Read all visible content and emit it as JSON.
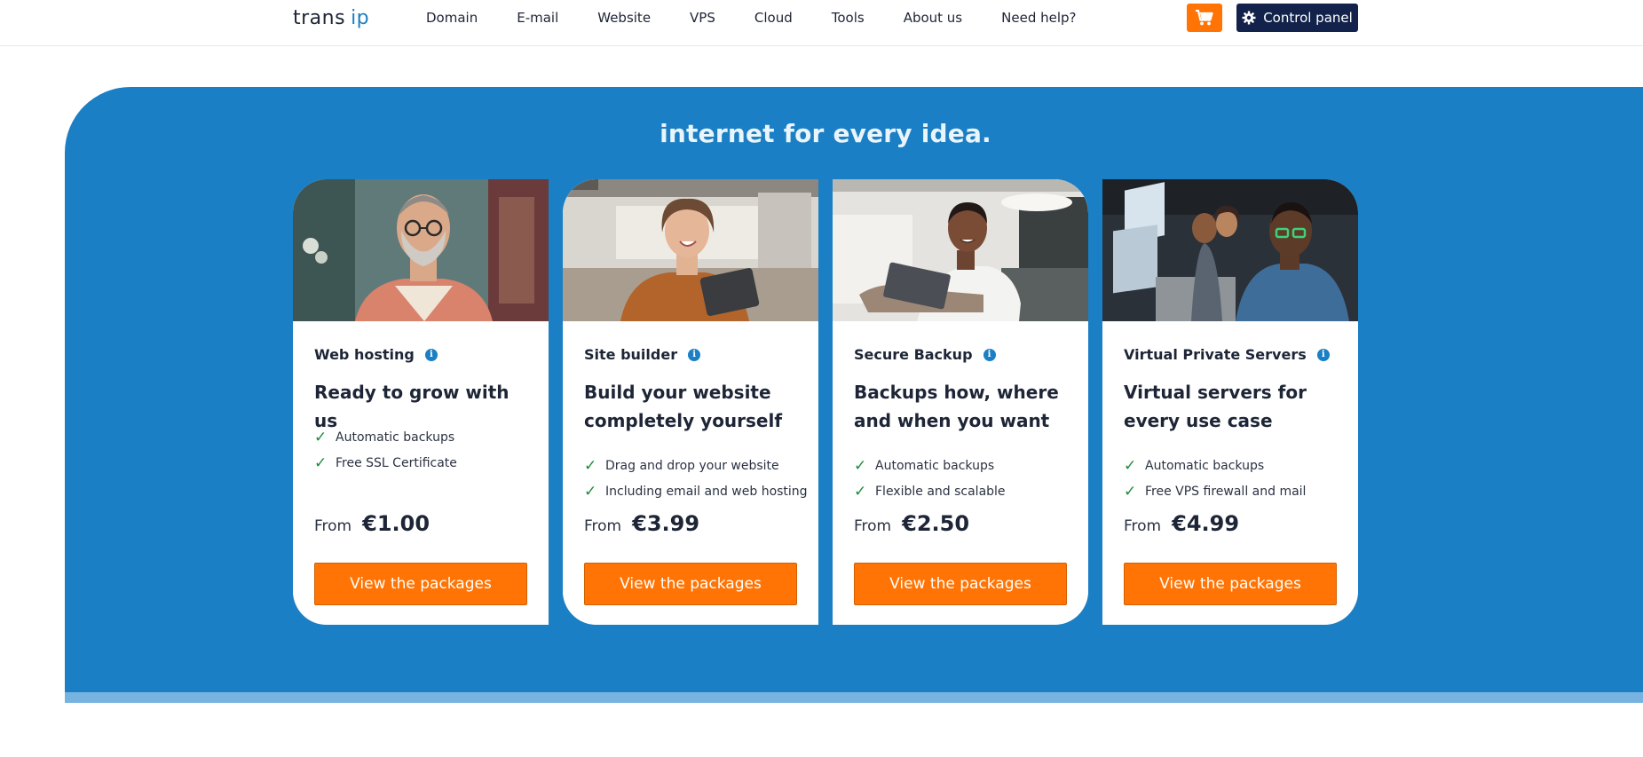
{
  "header": {
    "logo_part1": "trans",
    "logo_part2": "ip",
    "nav": [
      "Domain",
      "E-mail",
      "Website",
      "VPS",
      "Cloud",
      "Tools",
      "About us",
      "Need help?"
    ],
    "cart_icon": "cart-icon",
    "control_panel_label": "Control panel",
    "control_panel_icon": "gear-icon"
  },
  "hero": {
    "title": "internet for every idea."
  },
  "colors": {
    "brand_blue": "#1a7fc4",
    "accent_orange": "#ff7404",
    "navy": "#12224a",
    "check_green": "#1e8a3e"
  },
  "cards": [
    {
      "service": "Web hosting",
      "headline": "Ready to grow with us",
      "features": [
        "Automatic backups",
        "Free SSL Certificate"
      ],
      "from_label": "From",
      "price": "€1.00",
      "cta": "View the packages"
    },
    {
      "service": "Site builder",
      "headline": "Build your website completely yourself",
      "features": [
        "Drag and drop your website",
        "Including email and web hosting"
      ],
      "from_label": "From",
      "price": "€3.99",
      "cta": "View the packages"
    },
    {
      "service": "Secure Backup",
      "headline": "Backups how, where and when you want",
      "features": [
        "Automatic backups",
        "Flexible and scalable"
      ],
      "from_label": "From",
      "price": "€2.50",
      "cta": "View the packages"
    },
    {
      "service": "Virtual Private Servers",
      "headline": "Virtual servers for every use case",
      "features": [
        "Automatic backups",
        "Free VPS firewall and mail"
      ],
      "from_label": "From",
      "price": "€4.99",
      "cta": "View the packages"
    }
  ]
}
